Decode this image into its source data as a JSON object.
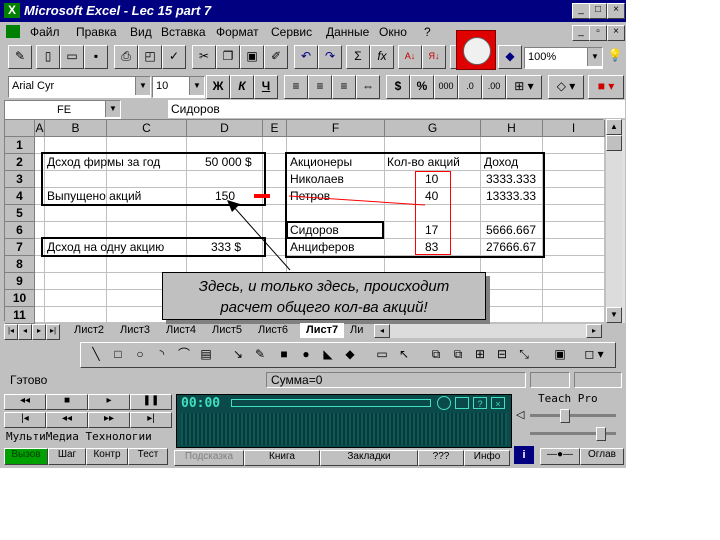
{
  "window": {
    "title": "Microsoft Excel - Lec 15  part 7"
  },
  "menu": [
    "Файл",
    "Правка",
    "Вид",
    "Вставка",
    "Формат",
    "Сервис",
    "Данные",
    "Окно",
    "?"
  ],
  "toolbar": {
    "zoom": "100%",
    "sigma": "Σ",
    "fx": "fx"
  },
  "format_toolbar": {
    "font": "Arial Cyr",
    "size": "10",
    "bold": "Ж",
    "italic": "К",
    "underline": "Ч",
    "currency": "$",
    "percent": "%"
  },
  "formula_bar": {
    "name_box": "FE",
    "content": "Сидоров"
  },
  "columns": [
    "A",
    "B",
    "C",
    "D",
    "E",
    "F",
    "G",
    "H",
    "I"
  ],
  "rows": [
    "1",
    "2",
    "3",
    "4",
    "5",
    "6",
    "7",
    "8",
    "9",
    "10",
    "11"
  ],
  "cells": {
    "b2": "Дсход фирмы за год",
    "d2": "50 000 $",
    "b4": "Выпущено акций",
    "d4": "150",
    "b7": "Дсход на одну акцию",
    "d7": "333 $",
    "f2": "Акционеры",
    "g2": "Кол-во акций",
    "h2": "Доход",
    "f3": "Николаев",
    "g3": "10",
    "h3": "3333.333",
    "f4": "Петров",
    "g4": "40",
    "h4": "13333.33",
    "f6": "Сидоров",
    "g6": "17",
    "h6": "5666.667",
    "f7": "Анциферов",
    "g7": "83",
    "h7": "27666.67"
  },
  "sheet_tabs": [
    "Лист2",
    "Лист3",
    "Лист4",
    "Лист5",
    "Лист6",
    "Лист7",
    "Ли"
  ],
  "active_tab": "Лист7",
  "callout": {
    "line1": "Здесь, и только здесь, происходит",
    "line2": "расчет общего кол-ва акций!"
  },
  "status": {
    "ready": "Гэтово",
    "sum": "Сумма=0"
  },
  "media": {
    "title": "Teach Pro",
    "company": "МультиМедиа Технологии",
    "time": "00:00",
    "btn_view": "Вызов",
    "btn_step": "Шаг",
    "btn_context": "Контр",
    "btn_test": "Тест",
    "btn_hint": "Подсказка",
    "btn_book": "Книга",
    "btn_bookmarks": "Закладки",
    "btn_question": "???",
    "btn_info": "Инфо",
    "btn_toc": "Оглав"
  },
  "colors": {
    "title": "#000080",
    "face": "#c0c0c0",
    "red_note": "#ff0000",
    "lcd": "#0a4a4a",
    "lcd_text": "#40e0c0"
  }
}
